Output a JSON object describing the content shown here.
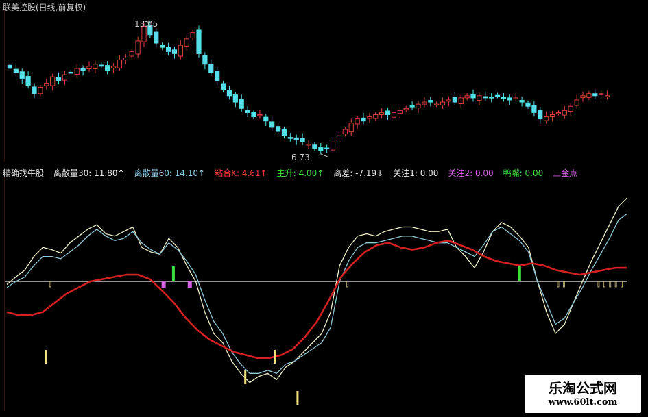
{
  "top_panel": {
    "title": "联美控股(日线,前复权)",
    "high_label": "13.05",
    "low_label": "6.73"
  },
  "indicator_header": {
    "name": "精确找牛股",
    "items": [
      {
        "text": "离散量30: 11.80↑",
        "color": "#e6e6e6"
      },
      {
        "text": "离散量60: 14.10↑",
        "color": "#8fd0e8"
      },
      {
        "text": "粘合K: 4.61↑",
        "color": "#ff3b3b"
      },
      {
        "text": "主升: 4.00↑",
        "color": "#3fdc3f"
      },
      {
        "text": "离差: -7.19↓",
        "color": "#e6e6e6"
      },
      {
        "text": "关注1: 0.00",
        "color": "#e6e6e6"
      },
      {
        "text": "关注2: 0.00",
        "color": "#d060e0"
      },
      {
        "text": "鸭嘴: 0.00",
        "color": "#3fdc3f"
      },
      {
        "text": "三金点",
        "color": "#d060e0"
      }
    ]
  },
  "watermark": {
    "line1": "乐淘公式网",
    "line2": "www.60lt.com"
  },
  "colors": {
    "up": "#e04040",
    "down": "#54e0e8",
    "line30": "#f0f0c8",
    "line60": "#8fc8d8",
    "redline": "#d42020",
    "zero": "#e8e8e8",
    "yellow": "#f2e27a",
    "green": "#3fdc3f",
    "magenta": "#d060e0"
  },
  "chart_data": [
    {
      "type": "candlestick",
      "title": "联美控股(日线,前复权)",
      "annotations": [
        {
          "label": "13.05",
          "kind": "high"
        },
        {
          "label": "6.73",
          "kind": "low"
        }
      ],
      "closes": [
        10.8,
        10.6,
        10.3,
        10.0,
        9.6,
        9.9,
        10.1,
        10.4,
        10.2,
        10.5,
        10.6,
        10.8,
        10.7,
        10.9,
        11.0,
        10.9,
        10.7,
        10.9,
        11.2,
        11.3,
        11.6,
        12.1,
        12.8,
        12.4,
        12.0,
        11.8,
        11.6,
        11.5,
        11.9,
        12.2,
        12.5,
        11.5,
        11.0,
        10.6,
        10.2,
        9.8,
        9.5,
        9.2,
        8.9,
        8.7,
        8.5,
        8.6,
        8.3,
        8.0,
        7.8,
        7.6,
        7.5,
        7.4,
        7.3,
        7.2,
        7.0,
        6.9,
        7.0,
        7.3,
        7.6,
        7.9,
        8.2,
        8.4,
        8.3,
        8.5,
        8.6,
        8.7,
        8.6,
        8.7,
        8.8,
        8.9,
        9.0,
        9.1,
        9.2,
        9.2,
        9.1,
        9.2,
        9.3,
        9.2,
        9.4,
        9.5,
        9.4,
        9.5,
        9.4,
        9.4,
        9.5,
        9.4,
        9.3,
        9.4,
        9.2,
        9.0,
        8.7,
        8.4,
        8.5,
        8.6,
        8.7,
        8.8,
        9.0,
        9.3,
        9.5,
        9.6,
        9.5,
        9.6,
        9.5
      ]
    },
    {
      "type": "line",
      "title": "精确找牛股",
      "series": [
        {
          "name": "离散量30",
          "values": [
            -2,
            4,
            10,
            22,
            30,
            28,
            25,
            34,
            40,
            46,
            50,
            42,
            40,
            44,
            48,
            30,
            26,
            24,
            38,
            30,
            14,
            0,
            -20,
            -34,
            -40,
            -52,
            -60,
            -66,
            -62,
            -60,
            -64,
            -56,
            -52,
            -46,
            -40,
            -34,
            -20,
            14,
            30,
            40,
            42,
            40,
            44,
            46,
            48,
            48,
            46,
            44,
            44,
            46,
            30,
            22,
            12,
            26,
            44,
            52,
            48,
            40,
            30,
            0,
            -20,
            -34,
            -28,
            -14,
            0,
            18,
            34,
            50,
            66,
            74
          ]
        },
        {
          "name": "离散量60",
          "values": [
            -4,
            0,
            4,
            14,
            22,
            22,
            20,
            26,
            32,
            40,
            46,
            40,
            36,
            38,
            44,
            34,
            28,
            24,
            34,
            28,
            18,
            6,
            -12,
            -26,
            -34,
            -46,
            -54,
            -60,
            -60,
            -58,
            -60,
            -54,
            -52,
            -48,
            -44,
            -40,
            -30,
            0,
            18,
            30,
            34,
            34,
            36,
            38,
            40,
            40,
            38,
            36,
            34,
            34,
            30,
            26,
            22,
            32,
            44,
            48,
            42,
            36,
            26,
            0,
            -14,
            -28,
            -24,
            -14,
            -4,
            10,
            24,
            38,
            54,
            60
          ]
        },
        {
          "name": "粘合K",
          "values": [
            -20,
            -22,
            -22,
            -20,
            -14,
            -8,
            -4,
            0,
            2,
            4,
            6,
            6,
            2,
            -6,
            -14,
            -24,
            -32,
            -38,
            -42,
            -46,
            -48,
            -50,
            -50,
            -48,
            -44,
            -36,
            -26,
            -12,
            4,
            16,
            26,
            32,
            34,
            30,
            28,
            30,
            34,
            36,
            32,
            28,
            22,
            18,
            16,
            14,
            16,
            14,
            10,
            8,
            6,
            8,
            10,
            12,
            12
          ]
        }
      ],
      "markers": [
        {
          "x": 12,
          "kind": "yellow"
        },
        {
          "x": 48,
          "kind": "magenta"
        },
        {
          "x": 51,
          "kind": "green"
        },
        {
          "x": 56,
          "kind": "magenta"
        },
        {
          "x": 73,
          "kind": "yellow"
        },
        {
          "x": 82,
          "kind": "yellow"
        },
        {
          "x": 89,
          "kind": "yellow"
        },
        {
          "x": 157,
          "kind": "green"
        },
        {
          "x": 179,
          "kind": "yellow"
        }
      ]
    }
  ]
}
